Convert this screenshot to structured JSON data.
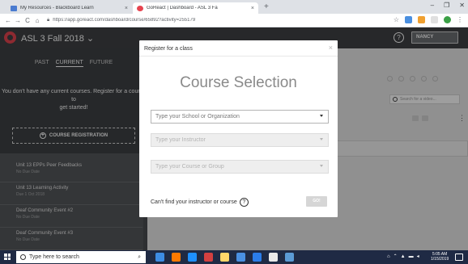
{
  "browser": {
    "tabs": [
      {
        "title": "My Resources - Blackboard Learn",
        "favicon_color": "#4a7bd0"
      },
      {
        "title": "GoReact | Dashboard - ASL 3 Fa",
        "favicon_color": "#e6444f"
      }
    ],
    "new_tab_label": "+",
    "close_label": "×",
    "url": "https://app.goreact.com/dashboard/course/65892?activity=255179",
    "window_controls": {
      "minimize": "–",
      "maximize": "❐",
      "close": "✕"
    }
  },
  "app": {
    "course_title": "ASL 3 Fall 2018 ⌄",
    "help_label": "?",
    "user_name": "NANCY"
  },
  "sidebar": {
    "tabs": [
      "PAST",
      "CURRENT",
      "FUTURE"
    ],
    "active_tab": "CURRENT",
    "empty_message_line1": "You don't have any current courses. Register for a course to",
    "empty_message_line2": "get started!",
    "register_button": "COURSE REGISTRATION",
    "activities": [
      {
        "name": "Unit 13 EPPs Peer Feedbacks",
        "date": "No Due Date"
      },
      {
        "name": "Unit 13 Learning Activity",
        "date": "Due 1 Oct 2018"
      },
      {
        "name": "Deaf Community Event #2",
        "date": "No Due Date"
      },
      {
        "name": "Deaf Community Event #3",
        "date": "No Due Date"
      }
    ]
  },
  "main": {
    "search_placeholder": "Search for a video...",
    "kebab_label": "⋮"
  },
  "modal": {
    "title": "Register for a class",
    "close_label": "×",
    "heading": "Course Selection",
    "fields": [
      {
        "placeholder": "Type your School or Organization",
        "enabled": true
      },
      {
        "placeholder": "Type your Instructor",
        "enabled": false
      },
      {
        "placeholder": "Type your Course or Group",
        "enabled": false
      }
    ],
    "help_text": "Can't find your instructor or course",
    "help_icon": "?",
    "go_button": "GO!"
  },
  "taskbar": {
    "search_placeholder": "Type here to search",
    "time": "5:05 AM",
    "date": "1/15/2019",
    "app_colors": [
      "#3d8ce4",
      "#ff7a00",
      "#1e90ff",
      "#d34040",
      "#ffd76a",
      "#4a90e2",
      "#2b7de9",
      "#e9e9e9",
      "#5b9bd5"
    ]
  },
  "colors": {
    "brand_red": "#e6444f",
    "header_bg": "#3f4244",
    "sidebar_bg": "#3e4144",
    "taskbar_bg": "#1f2a44"
  }
}
